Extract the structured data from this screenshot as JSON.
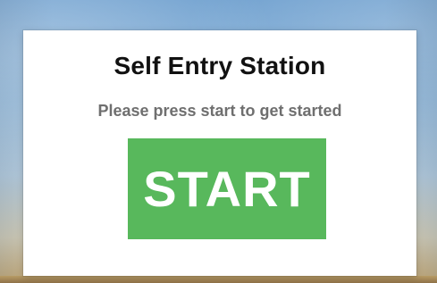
{
  "dialog": {
    "title": "Self Entry Station",
    "subtitle": "Please press start to get started",
    "start_label": "START"
  },
  "colors": {
    "start_button": "#58b85c",
    "title_text": "#111111",
    "subtitle_text": "#6f6f6f",
    "dialog_background": "#ffffff"
  }
}
